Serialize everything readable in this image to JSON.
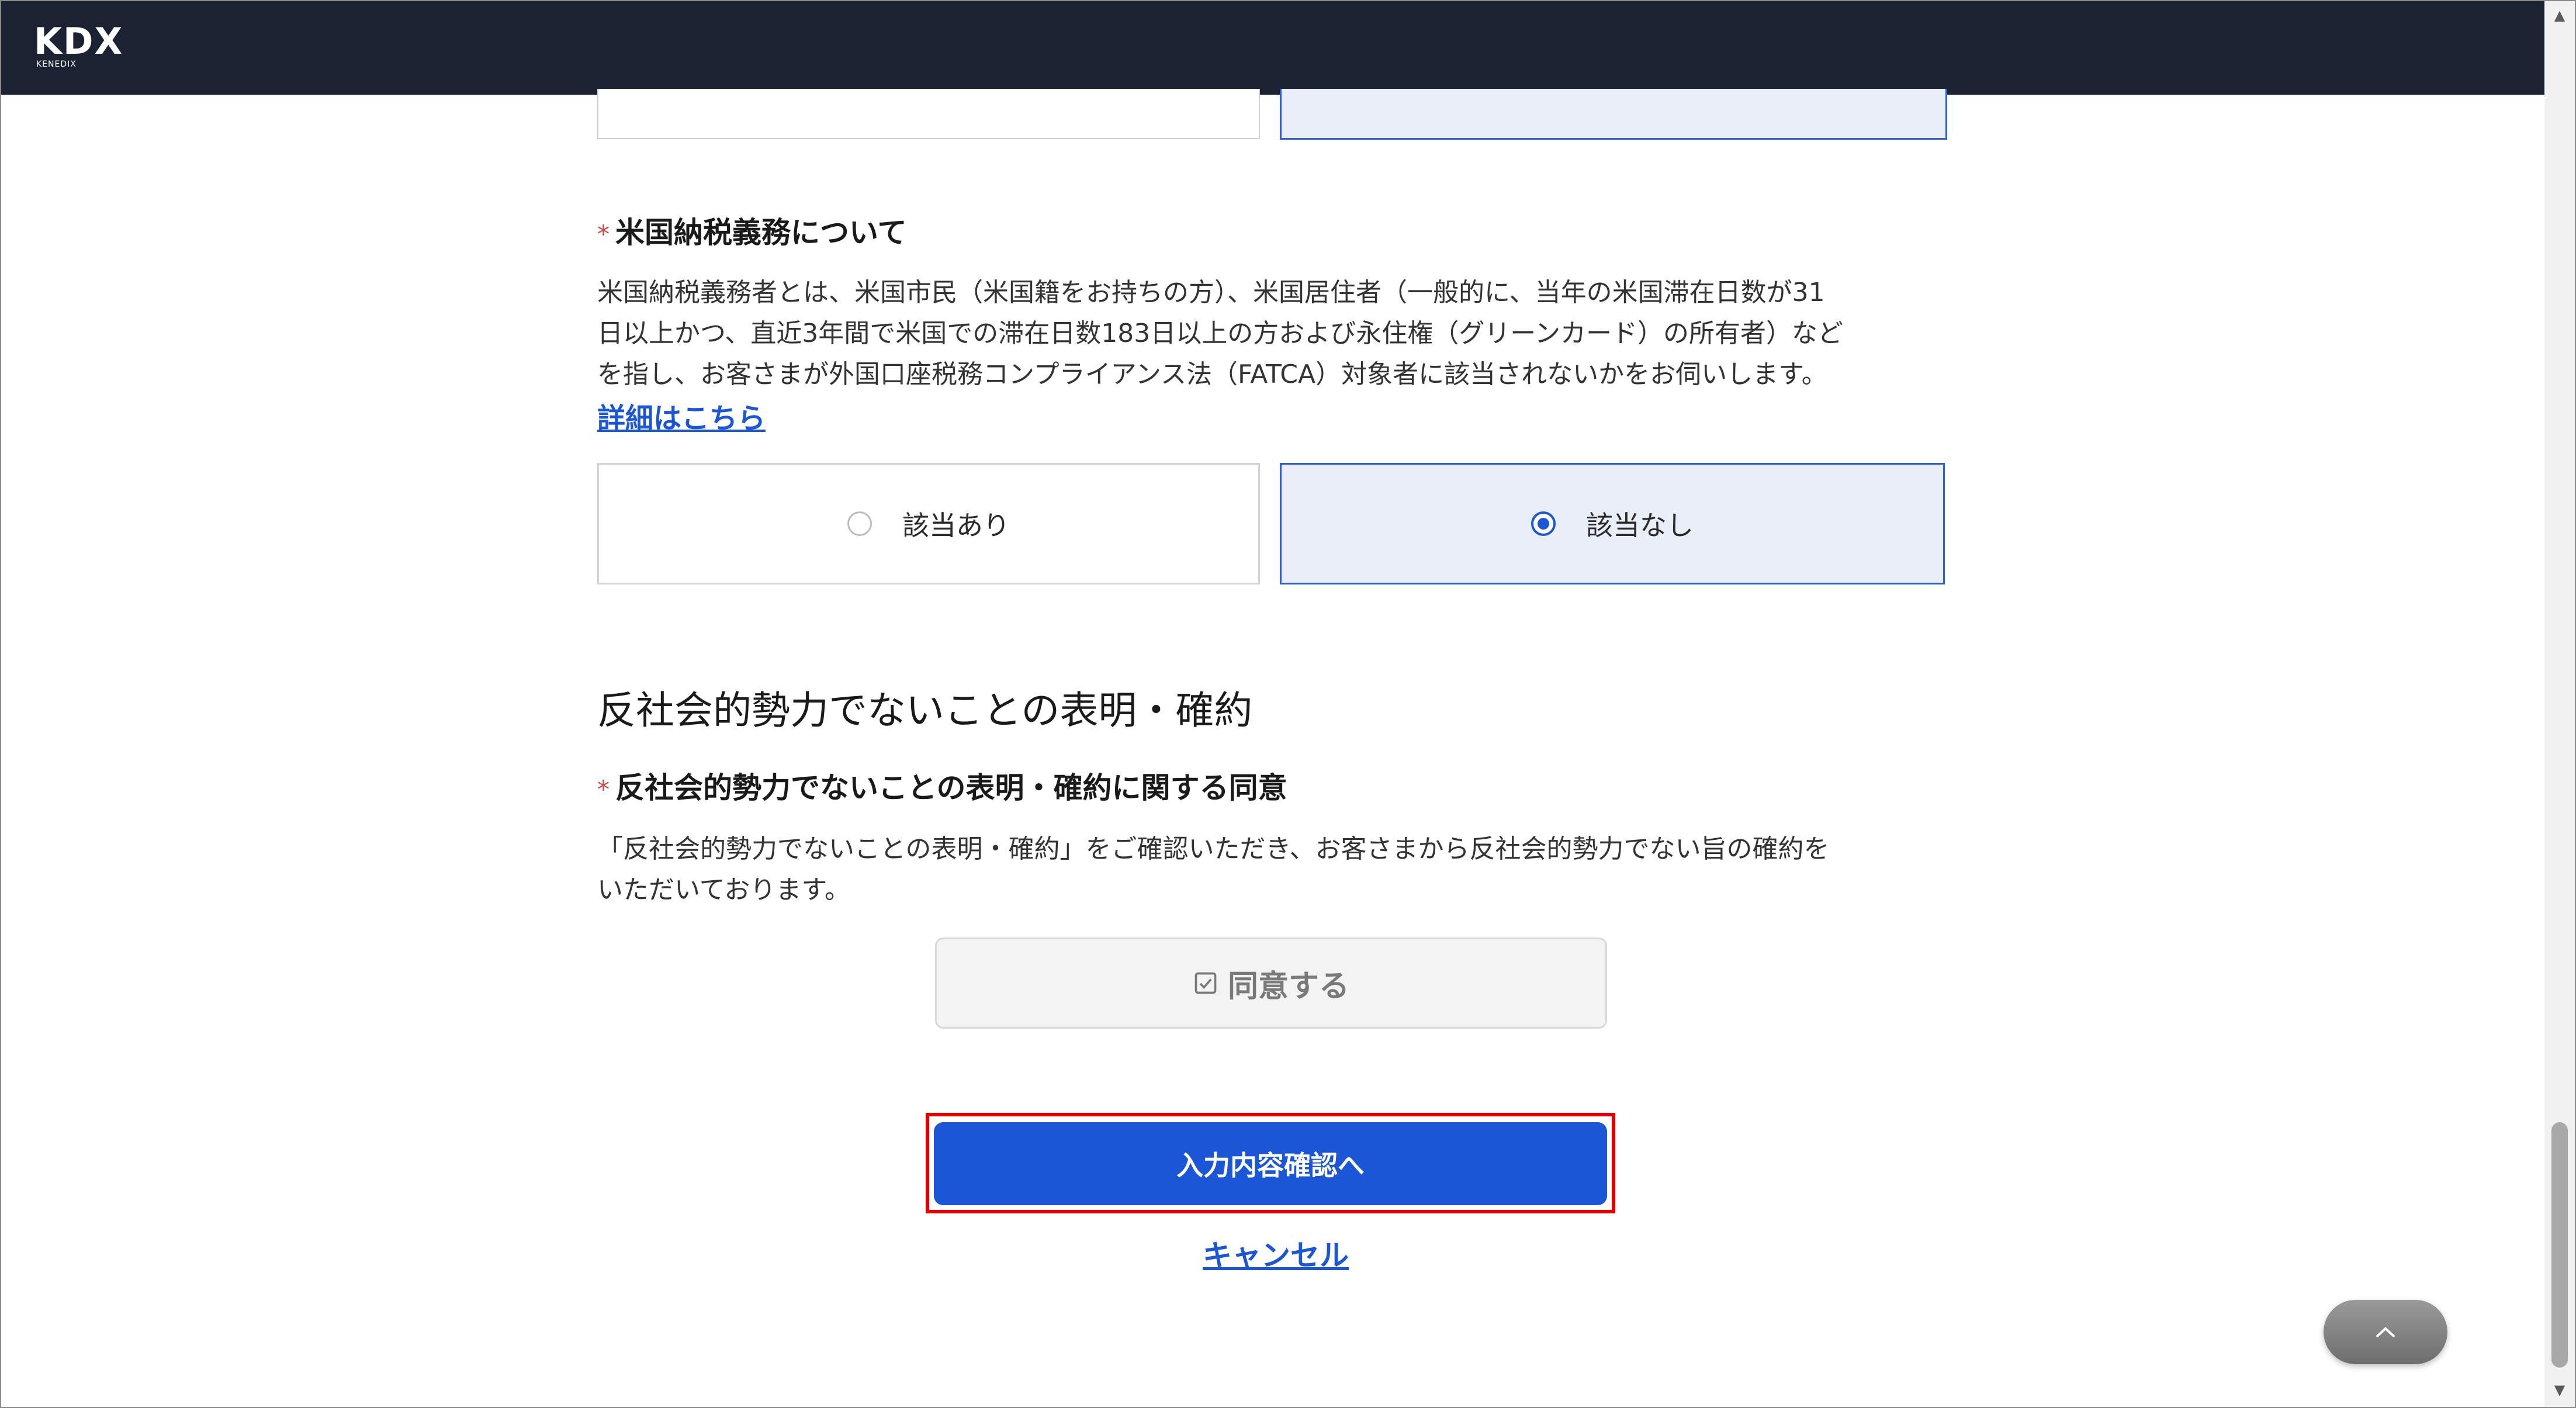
{
  "header": {
    "logo_text": "KDX",
    "logo_subtext": "KENEDIX"
  },
  "fatca": {
    "label": "米国納税義務について",
    "required_mark": "*",
    "description_line1": "米国納税義務者とは、米国市民（米国籍をお持ちの方）、米国居住者（一般的に、当年の米国滞在日数が31",
    "description_line2": "日以上かつ、直近3年間で米国での滞在日数183日以上の方および永住権（グリーンカード）の所有者）など",
    "description_line3": "を指し、お客さまが外国口座税務コンプライアンス法（FATCA）対象者に該当されないかをお伺いします。",
    "details_link": "詳細はこちら",
    "options": [
      {
        "label": "該当あり",
        "selected": false
      },
      {
        "label": "該当なし",
        "selected": true
      }
    ]
  },
  "antisocial": {
    "section_title": "反社会的勢力でないことの表明・確約",
    "label": "反社会的勢力でないことの表明・確約に関する同意",
    "required_mark": "*",
    "description_line1": "「反社会的勢力でないことの表明・確約」をご確認いただき、お客さまから反社会的勢力でない旨の確約を",
    "description_line2": "いただいております。",
    "agree_button": "同意する",
    "agree_checked": true
  },
  "actions": {
    "confirm_button": "入力内容確認へ",
    "cancel_link": "キャンセル"
  },
  "icons": {
    "back_to_top": "chevron-up-icon",
    "agree": "checkbox-checked-icon",
    "scroll_up": "triangle-up-icon",
    "scroll_down": "triangle-down-icon"
  },
  "colors": {
    "header_bg": "#1b2333",
    "primary": "#1a56d6",
    "selected_bg": "#e9eef9",
    "required": "#d64545",
    "highlight_outline": "#e00000"
  }
}
